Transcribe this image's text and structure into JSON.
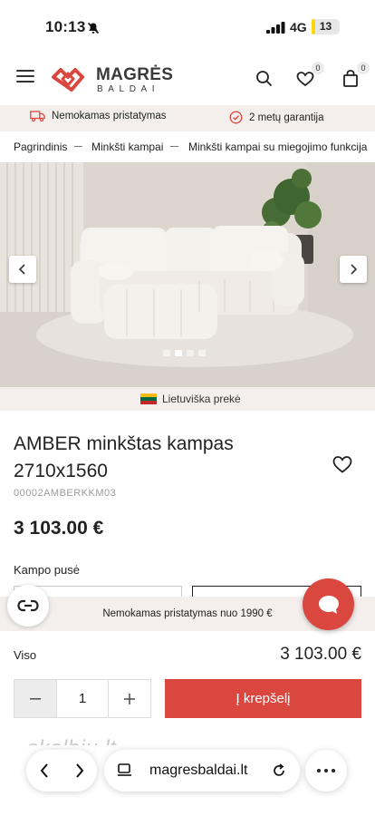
{
  "status_bar": {
    "time": "10:13",
    "network": "4G",
    "battery": "13",
    "battery_level": 0.13
  },
  "header": {
    "logo_top": "MAGRĖS",
    "logo_bottom": "BALDAI",
    "wishlist_count": "0",
    "cart_count": "0"
  },
  "benefits": [
    {
      "label": "Nemokamas pristatymas",
      "icon": "truck-icon"
    },
    {
      "label": "2 metų garantija",
      "icon": "check-badge-icon"
    }
  ],
  "breadcrumb": [
    "Pagrindinis",
    "Minkšti kampai",
    "Minkšti kampai su miegojimo funkcija"
  ],
  "gallery": {
    "slide_count": 4,
    "active_slide": 2
  },
  "origin_label": "Lietuviška prekė",
  "product": {
    "title": "AMBER minkštas kampas 2710x1560",
    "sku": "00002AMBERKKM03",
    "price": "3 103.00 €",
    "option_label": "Kampo pusė"
  },
  "free_shipping_banner": "Nemokamas pristatymas nuo 1990 €",
  "total": {
    "label": "Viso",
    "value": "3 103.00 €"
  },
  "quantity": "1",
  "cart_button": "Į krepšelį",
  "watermark": "skelbiu.lt",
  "browser": {
    "url": "magresbaldai.lt"
  },
  "colors": {
    "accent": "#d9473f",
    "band": "#f4efec",
    "flag": [
      "#fdb913",
      "#006a44",
      "#c1272d"
    ]
  }
}
